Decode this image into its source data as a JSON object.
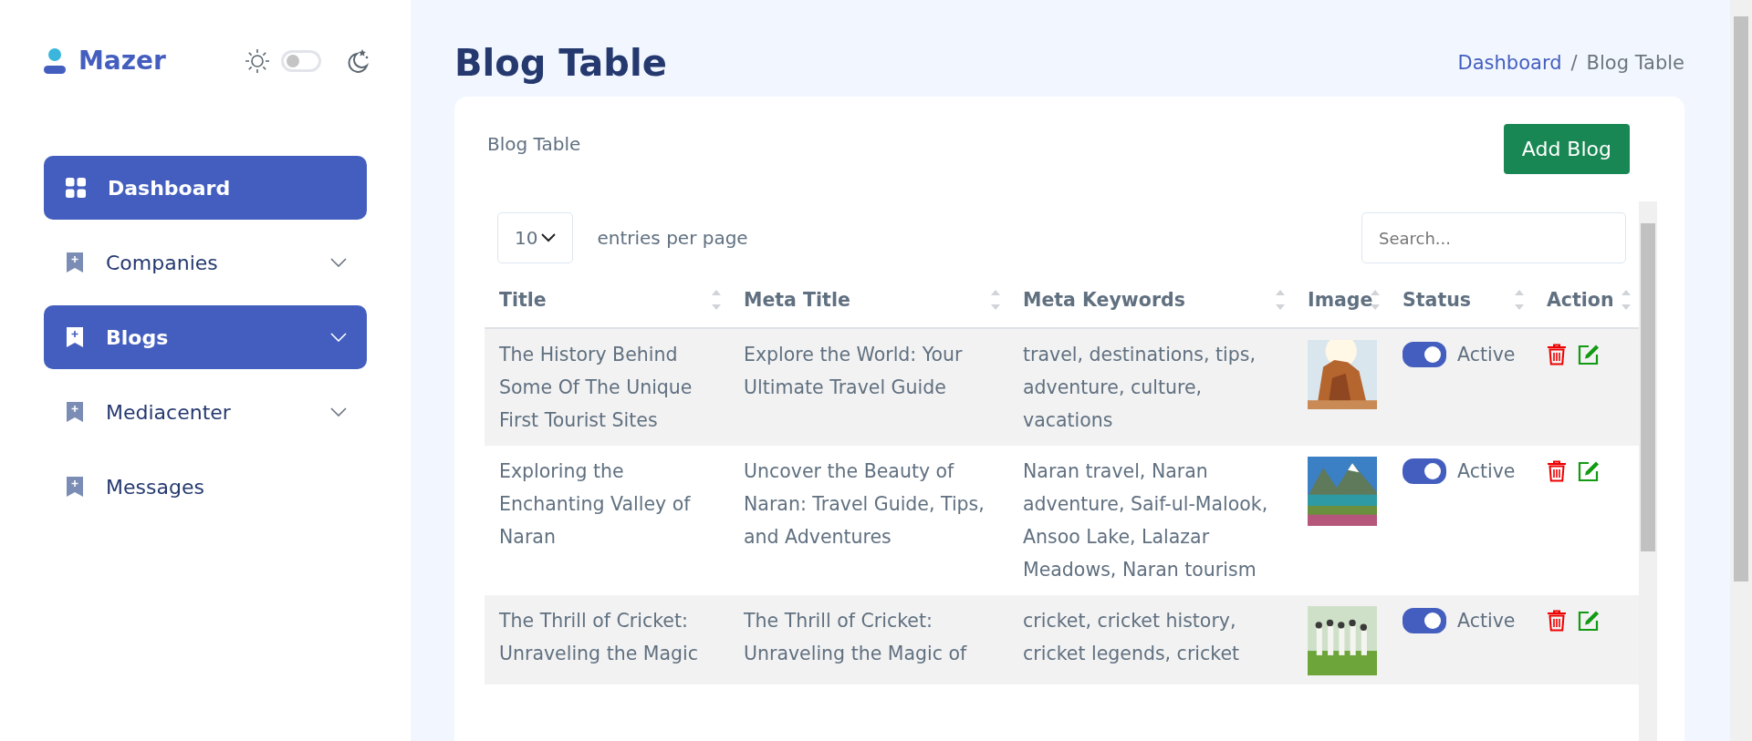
{
  "sidebar": {
    "brand": "Mazer",
    "dark_mode": false,
    "items": [
      {
        "label": "Dashboard",
        "kind": "link",
        "selected": true
      },
      {
        "label": "Companies",
        "kind": "submenu",
        "selected": false
      },
      {
        "label": "Blogs",
        "kind": "submenu",
        "selected": true
      },
      {
        "label": "Mediacenter",
        "kind": "submenu",
        "selected": false
      },
      {
        "label": "Messages",
        "kind": "link",
        "selected": false
      }
    ]
  },
  "page": {
    "title": "Blog Table",
    "breadcrumb": [
      {
        "label": "Dashboard",
        "kind": "link"
      },
      {
        "label": "Blog Table",
        "kind": "current"
      }
    ],
    "separator": "/"
  },
  "card": {
    "title": "Blog Table",
    "add_button": "Add Blog",
    "page_size": "10",
    "page_size_label": "entries per page",
    "search": {
      "placeholder": "Search..."
    },
    "table": {
      "columns": [
        "Title",
        "Meta Title",
        "Meta Keywords",
        "Image",
        "Status",
        "Action"
      ],
      "rows": [
        {
          "title": "The History Behind Some Of The Unique First Tourist Sites",
          "meta_title": "Explore the World: Your Ultimate Travel Guide",
          "meta_keywords": "travel, destinations, tips, adventure, culture, vacations",
          "active": true,
          "status": "Active"
        },
        {
          "title": "Exploring the Enchanting Valley of Naran",
          "meta_title": "Uncover the Beauty of Naran: Travel Guide, Tips, and Adventures",
          "meta_keywords": "Naran travel, Naran adventure, Saif-ul-Malook, Ansoo Lake, Lalazar Meadows, Naran tourism",
          "active": true,
          "status": "Active"
        },
        {
          "title": "The Thrill of Cricket: Unraveling the Magic",
          "meta_title": "The Thrill of Cricket: Unraveling the Magic of",
          "meta_keywords": "cricket, cricket history, cricket legends, cricket",
          "active": true,
          "status": "Active"
        }
      ]
    }
  }
}
